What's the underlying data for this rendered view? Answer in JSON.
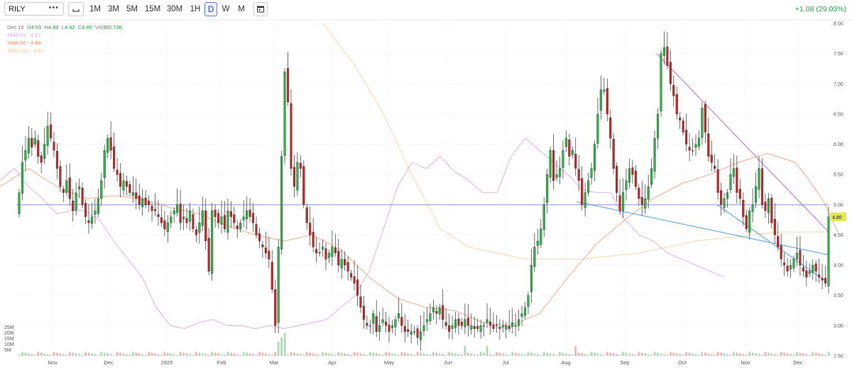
{
  "toolbar": {
    "symbol": "RILY",
    "timeframes": [
      "1M",
      "3M",
      "5M",
      "15M",
      "30M",
      "1H",
      "D",
      "W",
      "M"
    ],
    "active_timeframe": "D",
    "change": "+1.08 (29.03%)"
  },
  "legend": {
    "date": "Dec 16",
    "open_label": "O",
    "open": "4.65",
    "high_label": "H",
    "high": "4.88",
    "low_label": "L",
    "low": "4.42",
    "close_label": "C",
    "close": "4.80",
    "vol_label": "Vol",
    "vol": "380.73K",
    "sma20_label": "SMA 20",
    "sma20": "4.17",
    "sma50_label": "SMA 50",
    "sma50": "4.89",
    "sma200_label": "SMA 200",
    "sma200": "4.51"
  },
  "colors": {
    "up": "#2eb84b",
    "down": "#c42b2b",
    "sma20": "#d9a6e3",
    "sma50": "#f3a07a",
    "sma200": "#f5cf9e",
    "hline": "#8e8fd8",
    "trend_purple": "#c06ad3",
    "trend_blue": "#4a9fe0",
    "price_badge": "#e6e84a"
  },
  "icons": [
    "more-icon",
    "candle-type-icon",
    "calendar-icon"
  ],
  "chart_data": {
    "type": "candlestick",
    "y_axis_labels": [
      "8.00",
      "7.50",
      "7.00",
      "6.50",
      "6.00",
      "5.50",
      "5.00",
      "4.50",
      "4.00",
      "3.50",
      "3.00",
      "2.50"
    ],
    "ylim": [
      2.5,
      8.0
    ],
    "x_axis_labels": [
      "Nov",
      "Dec",
      "2025",
      "Feb",
      "Mar",
      "Apr",
      "May",
      "Jun",
      "Jul",
      "Aug",
      "Sep",
      "Oct",
      "Nov",
      "Dec"
    ],
    "volume_axis_labels": [
      "25M",
      "20M",
      "15M",
      "10M",
      "5M"
    ],
    "last_price_label": "4.80",
    "horizontal_line": 5.0,
    "closes": [
      5.2,
      5.7,
      5.9,
      6.1,
      5.95,
      6.1,
      5.8,
      5.7,
      6.0,
      6.3,
      6.1,
      5.9,
      5.6,
      5.3,
      5.2,
      5.4,
      5.1,
      4.9,
      5.2,
      5.3,
      5.0,
      4.8,
      4.7,
      4.8,
      4.9,
      5.1,
      5.4,
      5.9,
      6.1,
      5.9,
      5.6,
      5.5,
      5.3,
      5.4,
      5.3,
      5.2,
      5.2,
      5.1,
      5.0,
      5.1,
      5.0,
      5.0,
      4.9,
      4.9,
      4.8,
      4.7,
      4.6,
      4.7,
      4.8,
      4.9,
      5.0,
      4.7,
      4.8,
      4.7,
      4.9,
      4.6,
      4.5,
      4.7,
      4.9,
      4.4,
      3.9,
      4.9,
      4.8,
      4.7,
      4.8,
      4.6,
      4.9,
      4.8,
      4.7,
      4.6,
      4.7,
      4.8,
      4.9,
      4.8,
      4.7,
      4.5,
      4.4,
      4.3,
      4.2,
      4.1,
      3.6,
      3.0,
      4.3,
      5.8,
      7.2,
      6.7,
      5.6,
      5.3,
      5.7,
      5.6,
      5.0,
      4.7,
      4.5,
      4.3,
      4.2,
      4.2,
      4.3,
      4.1,
      4.2,
      4.3,
      4.2,
      4.0,
      4.1,
      4.0,
      3.9,
      3.8,
      3.7,
      3.5,
      3.3,
      3.1,
      3.0,
      3.0,
      3.2,
      2.9,
      3.0,
      3.1,
      3.0,
      2.9,
      3.0,
      3.1,
      3.2,
      3.0,
      2.9,
      2.9,
      2.9,
      2.9,
      2.8,
      2.9,
      3.0,
      3.1,
      3.2,
      3.3,
      3.2,
      3.3,
      3.1,
      3.0,
      2.9,
      3.0,
      3.1,
      3.0,
      3.0,
      3.1,
      3.0,
      3.0,
      2.95,
      2.95,
      3.0,
      3.0,
      3.1,
      3.0,
      2.95,
      3.0,
      2.95,
      3.0,
      3.0,
      2.95,
      3.05,
      3.0,
      3.1,
      3.2,
      3.3,
      3.5,
      4.0,
      4.3,
      4.4,
      4.6,
      5.0,
      5.5,
      5.9,
      5.4,
      5.5,
      5.6,
      5.9,
      6.1,
      5.8,
      5.9,
      5.6,
      5.4,
      5.0,
      5.2,
      5.4,
      5.6,
      6.0,
      6.5,
      6.9,
      6.9,
      6.5,
      6.1,
      5.6,
      5.2,
      4.9,
      5.2,
      5.4,
      5.6,
      5.5,
      5.3,
      5.1,
      5.0,
      5.1,
      5.3,
      5.6,
      6.1,
      6.5,
      7.5,
      7.6,
      7.3,
      7.0,
      6.8,
      6.5,
      6.4,
      6.2,
      6.0,
      5.9,
      5.9,
      6.0,
      6.1,
      6.6,
      6.2,
      5.8,
      5.7,
      5.6,
      5.2,
      5.0,
      5.1,
      5.2,
      5.5,
      5.6,
      5.2,
      5.1,
      4.8,
      4.6,
      4.9,
      5.0,
      5.3,
      5.6,
      5.0,
      4.9,
      5.1,
      4.7,
      4.5,
      4.3,
      4.1,
      4.0,
      3.9,
      4.0,
      4.1,
      4.2,
      4.0,
      3.9,
      3.8,
      3.9,
      4.0,
      3.9,
      3.8,
      3.75,
      3.7,
      4.8
    ],
    "sma20": [
      [
        0,
        5.4
      ],
      [
        20,
        5.6
      ],
      [
        40,
        5.3
      ],
      [
        60,
        5.1
      ],
      [
        80,
        4.85
      ],
      [
        100,
        4.9
      ],
      [
        120,
        4.9
      ],
      [
        140,
        4.75
      ],
      [
        160,
        4.4
      ],
      [
        180,
        4.1
      ],
      [
        200,
        3.8
      ],
      [
        220,
        3.3
      ],
      [
        240,
        3.0
      ],
      [
        260,
        2.95
      ],
      [
        280,
        3.05
      ],
      [
        300,
        3.1
      ],
      [
        320,
        3.0
      ],
      [
        340,
        3.0
      ],
      [
        360,
        2.95
      ],
      [
        380,
        3.0
      ],
      [
        400,
        2.95
      ],
      [
        420,
        3.0
      ],
      [
        440,
        3.05
      ],
      [
        460,
        3.1
      ],
      [
        480,
        3.3
      ],
      [
        500,
        3.5
      ],
      [
        520,
        3.9
      ],
      [
        540,
        4.6
      ],
      [
        560,
        5.3
      ],
      [
        580,
        5.7
      ],
      [
        600,
        5.6
      ],
      [
        620,
        5.8
      ],
      [
        640,
        5.55
      ],
      [
        660,
        5.4
      ],
      [
        680,
        5.2
      ],
      [
        700,
        5.2
      ],
      [
        720,
        5.8
      ],
      [
        740,
        6.1
      ],
      [
        760,
        5.9
      ],
      [
        780,
        5.7
      ],
      [
        800,
        5.5
      ],
      [
        820,
        5.25
      ],
      [
        840,
        5.2
      ],
      [
        860,
        5.2
      ],
      [
        880,
        4.75
      ],
      [
        900,
        4.5
      ],
      [
        920,
        4.4
      ],
      [
        940,
        4.2
      ],
      [
        960,
        4.1
      ],
      [
        980,
        4.0
      ],
      [
        1000,
        3.9
      ],
      [
        1020,
        3.8
      ]
    ],
    "sma50": [
      [
        0,
        5.3
      ],
      [
        40,
        5.6
      ],
      [
        80,
        5.3
      ],
      [
        120,
        5.1
      ],
      [
        160,
        5.15
      ],
      [
        200,
        5.1
      ],
      [
        240,
        4.95
      ],
      [
        280,
        4.85
      ],
      [
        320,
        4.65
      ],
      [
        360,
        4.5
      ],
      [
        400,
        4.4
      ],
      [
        440,
        4.5
      ],
      [
        480,
        4.25
      ],
      [
        520,
        3.8
      ],
      [
        560,
        3.45
      ],
      [
        600,
        3.3
      ],
      [
        640,
        3.25
      ],
      [
        680,
        3.05
      ],
      [
        720,
        3.0
      ],
      [
        760,
        3.2
      ],
      [
        800,
        3.8
      ],
      [
        840,
        4.35
      ],
      [
        880,
        4.75
      ],
      [
        920,
        5.1
      ],
      [
        960,
        5.35
      ],
      [
        1000,
        5.5
      ],
      [
        1040,
        5.7
      ],
      [
        1080,
        5.85
      ],
      [
        1120,
        5.7
      ],
      [
        1140,
        5.4
      ],
      [
        1160,
        5.05
      ],
      [
        1180,
        4.55
      ]
    ],
    "sma200": [
      [
        455,
        8.0
      ],
      [
        500,
        7.3
      ],
      [
        540,
        6.5
      ],
      [
        580,
        5.5
      ],
      [
        620,
        4.6
      ],
      [
        660,
        4.3
      ],
      [
        700,
        4.2
      ],
      [
        740,
        4.1
      ],
      [
        780,
        4.1
      ],
      [
        820,
        4.1
      ],
      [
        860,
        4.15
      ],
      [
        900,
        4.2
      ],
      [
        940,
        4.3
      ],
      [
        980,
        4.4
      ],
      [
        1020,
        4.45
      ],
      [
        1060,
        4.5
      ],
      [
        1100,
        4.55
      ],
      [
        1140,
        4.55
      ],
      [
        1170,
        4.55
      ]
    ],
    "trendlines": [
      {
        "color": "purple",
        "from": [
          925,
          7.5
        ],
        "to": [
          1167,
          4.55
        ]
      },
      {
        "color": "blue",
        "from": [
          812,
          5.05
        ],
        "to": [
          1167,
          4.17
        ]
      },
      {
        "color": "blue",
        "from": [
          1010,
          5.0
        ],
        "to": [
          1165,
          3.72
        ]
      }
    ]
  }
}
